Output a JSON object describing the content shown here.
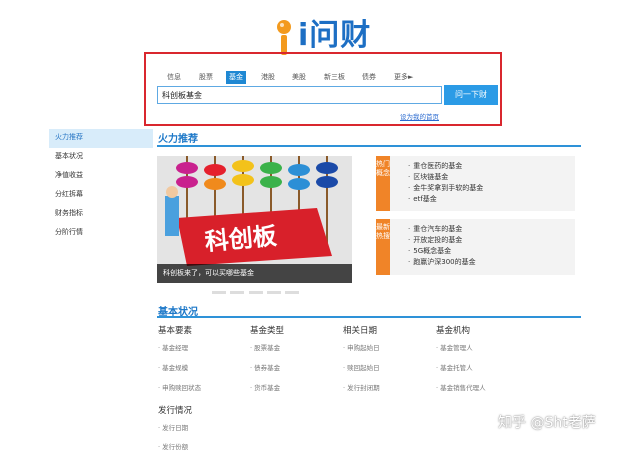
{
  "logo": {
    "text": "i问财"
  },
  "tabs": [
    {
      "label": "信息",
      "active": false
    },
    {
      "label": "股票",
      "active": false
    },
    {
      "label": "基金",
      "active": true
    },
    {
      "label": "港股",
      "active": false
    },
    {
      "label": "美股",
      "active": false
    },
    {
      "label": "新三板",
      "active": false
    },
    {
      "label": "债券",
      "active": false
    },
    {
      "label": "更多►",
      "active": false
    }
  ],
  "search": {
    "value": "科创板基金",
    "button": "问一下财",
    "homepage_link": "设为我的首页"
  },
  "leftnav": [
    {
      "label": "火力推荐",
      "active": true
    },
    {
      "label": "基本状况",
      "active": false
    },
    {
      "label": "净值收益",
      "active": false
    },
    {
      "label": "分红拆幕",
      "active": false
    },
    {
      "label": "财务指标",
      "active": false
    },
    {
      "label": "分阶行情",
      "active": false
    }
  ],
  "recommend": {
    "title": "火力推荐",
    "banner_text": "科创板",
    "banner_caption": "科创板来了，可以买哪些基金",
    "hot": {
      "label": "热门概念",
      "items": [
        "重仓医药的基金",
        "区块链基金",
        "金牛奖拿到手软的基金",
        "etf基金"
      ]
    },
    "new": {
      "label": "最新热搜",
      "items": [
        "重仓汽车的基金",
        "开放定投的基金",
        "5G概念基金",
        "跑赢沪深300的基金"
      ]
    }
  },
  "basic": {
    "title": "基本状况",
    "columns": [
      {
        "head": "基本要素",
        "items": [
          "基金经理",
          "基金规模",
          "申购赎回状态"
        ]
      },
      {
        "head": "基金类型",
        "items": [
          "股票基金",
          "债券基金",
          "货币基金"
        ]
      },
      {
        "head": "相关日期",
        "items": [
          "申购起始日",
          "赎回起始日",
          "发行封闭期"
        ]
      },
      {
        "head": "基金机构",
        "items": [
          "基金管理人",
          "基金托管人",
          "基金销售代理人"
        ]
      }
    ],
    "issue": {
      "head": "发行情况",
      "items": [
        "发行日期",
        "发行份额"
      ]
    }
  },
  "watermark": "知乎 @Sht老萨",
  "colors": {
    "accent": "#1f88d3",
    "frame": "#d9272e",
    "hot": "#f08428"
  }
}
